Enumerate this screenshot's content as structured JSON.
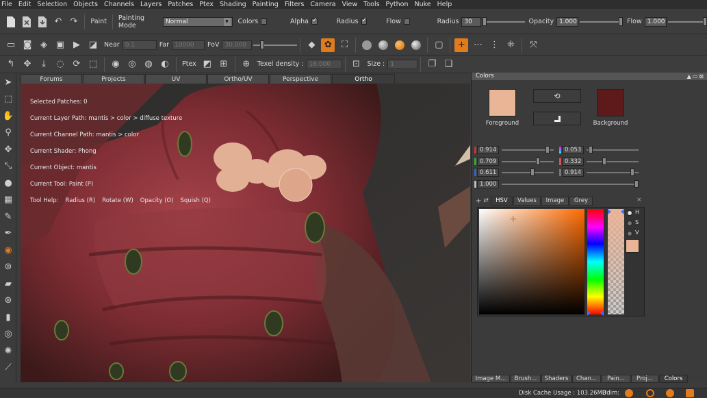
{
  "menu": [
    "File",
    "Edit",
    "Selection",
    "Objects",
    "Channels",
    "Layers",
    "Patches",
    "Ptex",
    "Shading",
    "Painting",
    "Filters",
    "Camera",
    "View",
    "Tools",
    "Python",
    "Nuke",
    "Help"
  ],
  "toolbar1": {
    "paint_label": "Paint",
    "painting_mode_label": "Painting Mode",
    "painting_mode_value": "Normal",
    "colors_label": "Colors",
    "alpha_label": "Alpha",
    "radius_check_label": "Radius",
    "flow_check_label": "Flow",
    "radius_label": "Radius",
    "radius_value": "30",
    "opacity_label": "Opacity",
    "opacity_value": "1.000",
    "flow_label": "Flow",
    "flow_value": "1.000"
  },
  "toolbar2": {
    "near_label": "Near",
    "near_value": "0.1",
    "far_label": "Far",
    "far_value": "10000",
    "fov_label": "FoV",
    "fov_value": "30.000"
  },
  "toolbar3": {
    "ptex_label": "Ptex",
    "texel_label": "Texel density :",
    "texel_value": "16.000",
    "size_label": "Size :",
    "size_value": "1"
  },
  "tabs": [
    {
      "label": "Forums",
      "active": false
    },
    {
      "label": "Projects",
      "active": false
    },
    {
      "label": "UV",
      "active": false
    },
    {
      "label": "Ortho/UV",
      "active": false
    },
    {
      "label": "Perspective",
      "active": false
    },
    {
      "label": "Ortho",
      "active": true
    }
  ],
  "hud": {
    "selected_patches": "Selected Patches: 0",
    "layer_path": "Current Layer Path: mantis > color > diffuse texture",
    "channel_path": "Current Channel Path: mantis > color",
    "shader": "Current Shader: Phong",
    "object": "Current Object: mantis",
    "tool": "Current Tool: Paint (P)",
    "help_label": "Tool Help:",
    "help_items": [
      "Radius (R)",
      "Rotate (W)",
      "Opacity (O)",
      "Squish (Q)"
    ]
  },
  "colors_panel": {
    "title": "Colors",
    "foreground_label": "Foreground",
    "background_label": "Background",
    "foreground_color": "#eab497",
    "background_color": "#5e1a1a",
    "fg_r": "0.914",
    "fg_g": "0.709",
    "fg_b": "0.611",
    "fg_a": "1.000",
    "bg_r": "0.053",
    "bg_g": "0.332",
    "bg_b": "0.914",
    "subtabs": [
      {
        "label": "HSV",
        "active": true
      },
      {
        "label": "Values",
        "active": false
      },
      {
        "label": "Image",
        "active": false
      },
      {
        "label": "Grey",
        "active": false
      }
    ],
    "hsv_h": "H",
    "hsv_s": "S",
    "hsv_v": "V",
    "bottom_tabs": [
      {
        "label": "Image M...",
        "active": false
      },
      {
        "label": "Brush...",
        "active": false
      },
      {
        "label": "Shaders",
        "active": false
      },
      {
        "label": "Chan...",
        "active": false
      },
      {
        "label": "Pain...",
        "active": false
      },
      {
        "label": "Proj...",
        "active": false
      },
      {
        "label": "Colors",
        "active": true
      }
    ]
  },
  "status": {
    "disk_cache": "Disk Cache Usage : 103.26MB",
    "udim_label": "Udim:"
  }
}
